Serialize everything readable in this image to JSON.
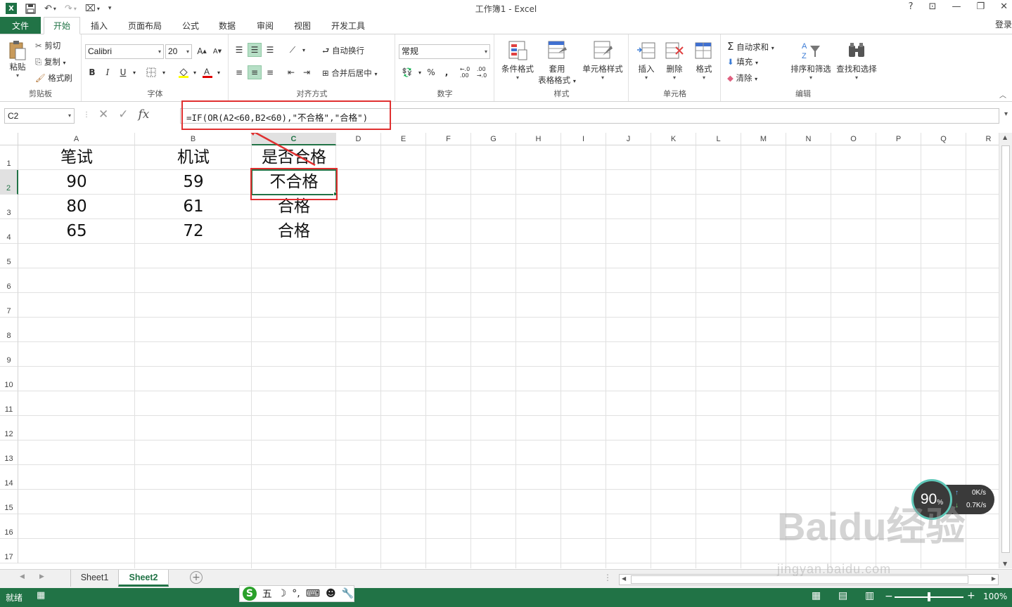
{
  "window": {
    "title": "工作簿1 - Excel",
    "help": "?",
    "minimize": "—",
    "restore": "❐",
    "close": "✕",
    "login": "登录"
  },
  "tabs": {
    "file": "文件",
    "items": [
      "开始",
      "插入",
      "页面布局",
      "公式",
      "数据",
      "审阅",
      "视图",
      "开发工具"
    ]
  },
  "ribbon": {
    "clipboard": {
      "paste": "粘贴",
      "cut": "剪切",
      "copy": "复制",
      "format_painter": "格式刷",
      "label": "剪贴板"
    },
    "font": {
      "font_name": "Calibri",
      "font_size": "20",
      "bold": "B",
      "italic": "I",
      "underline": "U",
      "label": "字体"
    },
    "alignment": {
      "wrap_text": "自动换行",
      "merge_center": "合并后居中",
      "label": "对齐方式"
    },
    "number": {
      "format": "常规",
      "percent": "%",
      "comma": ",",
      "label": "数字"
    },
    "styles": {
      "conditional": "条件格式",
      "table_format_1": "套用",
      "table_format_2": "表格格式",
      "cell_styles": "单元格样式",
      "label": "样式"
    },
    "cells": {
      "insert": "插入",
      "delete": "删除",
      "format": "格式",
      "label": "单元格"
    },
    "editing": {
      "autosum": "自动求和",
      "fill": "填充",
      "clear": "清除",
      "sort_filter": "排序和筛选",
      "find_select": "查找和选择",
      "label": "编辑"
    }
  },
  "formula_bar": {
    "name_box": "C2",
    "fx": "fx",
    "formula": "=IF(OR(A2<60,B2<60),\"不合格\",\"合格\")"
  },
  "columns": [
    "A",
    "B",
    "C",
    "D",
    "E",
    "F",
    "G",
    "H",
    "I",
    "J",
    "K",
    "L",
    "M",
    "N",
    "O",
    "P",
    "Q",
    "R"
  ],
  "rows": [
    "1",
    "2",
    "3",
    "4",
    "5",
    "6",
    "7",
    "8",
    "9",
    "10",
    "11",
    "12",
    "13",
    "14",
    "15",
    "16",
    "17"
  ],
  "cells": {
    "A1": "笔试",
    "B1": "机试",
    "C1": "是否合格",
    "A2": "90",
    "B2": "59",
    "C2": "不合格",
    "A3": "80",
    "B3": "61",
    "C3": "合格",
    "A4": "65",
    "B4": "72",
    "C4": "合格"
  },
  "sheets": [
    "Sheet1",
    "Sheet2"
  ],
  "active_sheet": "Sheet2",
  "status": {
    "ready": "就绪",
    "zoom": "100%"
  },
  "ime": {
    "logo": "S",
    "mode": "五"
  },
  "net_widget": {
    "percent": "90",
    "percent_unit": "%",
    "up": "0K/s",
    "down": "0.7K/s"
  },
  "watermark": {
    "brand": "Baidu经验",
    "url": "jingyan.baidu.com"
  },
  "colors": {
    "excel_green": "#217346",
    "highlight_red": "#e03030"
  }
}
